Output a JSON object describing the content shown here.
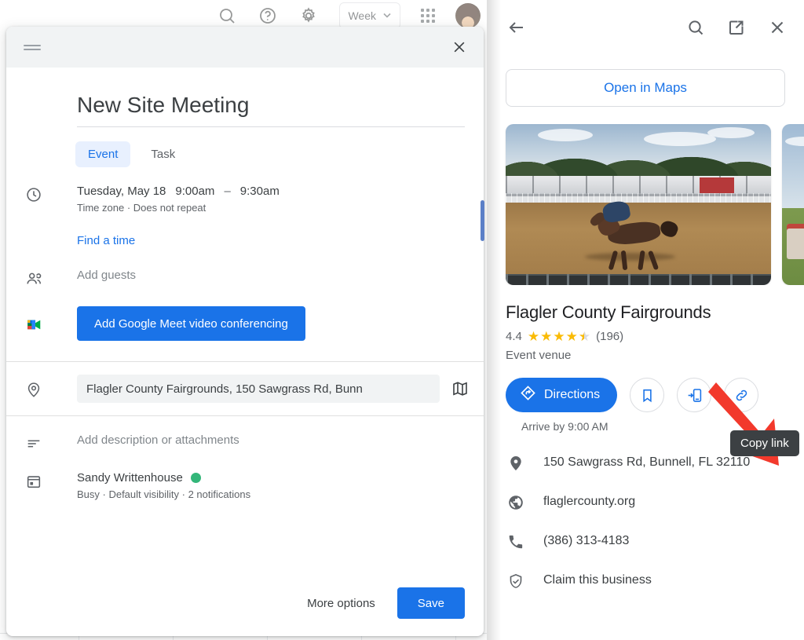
{
  "calendar_background": {
    "icons": [
      "search-icon",
      "help-icon",
      "settings-icon"
    ],
    "view_selector": {
      "label": "Week",
      "chevron": "chevron-down-icon"
    },
    "apps_grid": "apps-grid-icon",
    "avatar": "user-avatar"
  },
  "event_dialog": {
    "drag_handle": "drag-handle",
    "close": "close-icon",
    "title": "New Site Meeting",
    "tabs": [
      {
        "label": "Event",
        "active": true
      },
      {
        "label": "Task",
        "active": false
      }
    ],
    "datetime": {
      "icon": "clock-icon",
      "date": "Tuesday, May 18",
      "start_time": "9:00am",
      "dash": "–",
      "end_time": "9:30am",
      "subtitle": "Time zone · Does not repeat",
      "find_a_time": "Find a time"
    },
    "guests": {
      "icon": "people-icon",
      "placeholder": "Add guests"
    },
    "meet": {
      "icon": "google-meet-icon",
      "button_label": "Add Google Meet video conferencing"
    },
    "location": {
      "icon": "location-pin-icon",
      "value": "Flagler County Fairgrounds, 150 Sawgrass Rd, Bunn",
      "map_icon": "map-icon"
    },
    "description": {
      "icon": "description-icon",
      "placeholder": "Add description or attachments"
    },
    "calendar": {
      "icon": "calendar-icon",
      "owner": "Sandy Writtenhouse",
      "color": "#33b679",
      "details": "Busy · Default visibility · 2 notifications"
    },
    "footer": {
      "more_options": "More options",
      "save": "Save"
    }
  },
  "maps_panel": {
    "header": {
      "back": "back-arrow-icon",
      "search": "search-icon",
      "open_new": "open-in-new-icon",
      "close": "close-icon"
    },
    "open_in_maps": "Open in Maps",
    "photos": [
      {
        "alt": "rodeo-arena-photo"
      },
      {
        "alt": "fairgrounds-field-photo"
      }
    ],
    "place": {
      "name": "Flagler County Fairgrounds",
      "rating": "4.4",
      "stars": 4.5,
      "review_count": "(196)",
      "category": "Event venue"
    },
    "actions": {
      "directions": "Directions",
      "directions_icon": "directions-icon",
      "save_icon": "bookmark-icon",
      "send_to_phone_icon": "send-to-phone-icon",
      "copy_link_icon": "link-icon",
      "arrive_by": "Arrive by 9:00 AM"
    },
    "tooltip": "Copy link",
    "details": [
      {
        "icon": "location-pin-icon",
        "text": "150 Sawgrass Rd, Bunnell, FL 32110"
      },
      {
        "icon": "globe-icon",
        "text": "flaglercounty.org"
      },
      {
        "icon": "phone-icon",
        "text": "(386) 313-4183"
      },
      {
        "icon": "shield-check-icon",
        "text": "Claim this business"
      }
    ]
  },
  "colors": {
    "google_blue": "#1a73e8",
    "tab_active_bg": "#e8f0fe",
    "calendar_green": "#33b679",
    "star_gold": "#fabb05",
    "tooltip_bg": "#3c4043",
    "annotation_red": "#f2392c"
  }
}
